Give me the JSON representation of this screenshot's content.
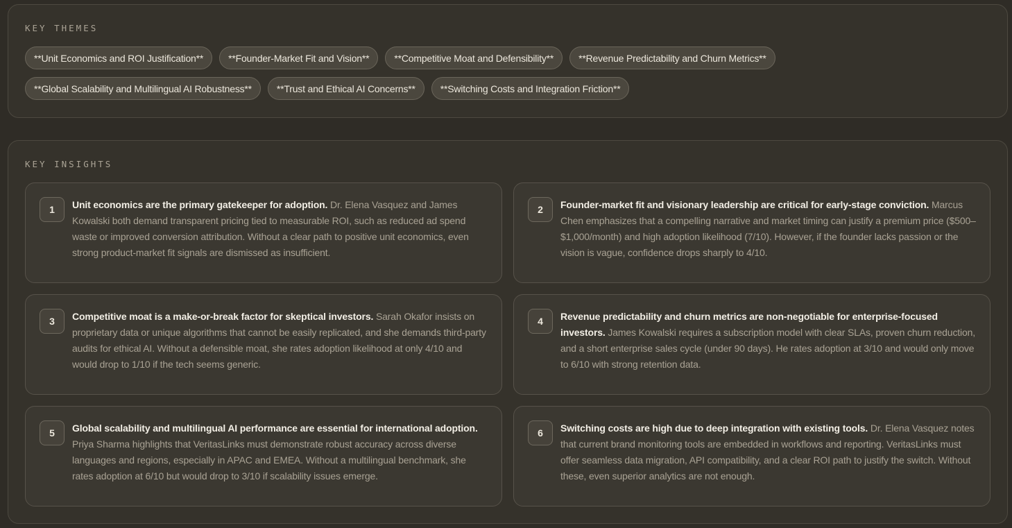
{
  "themes": {
    "label": "KEY THEMES",
    "items": [
      "**Unit Economics and ROI Justification**",
      "**Founder-Market Fit and Vision**",
      "**Competitive Moat and Defensibility**",
      "**Revenue Predictability and Churn Metrics**",
      "**Global Scalability and Multilingual AI Robustness**",
      "**Trust and Ethical AI Concerns**",
      "**Switching Costs and Integration Friction**"
    ]
  },
  "insights": {
    "label": "KEY INSIGHTS",
    "items": [
      {
        "number": "1",
        "lead": "Unit economics are the primary gatekeeper for adoption.",
        "body": "Dr. Elena Vasquez and James Kowalski both demand transparent pricing tied to measurable ROI, such as reduced ad spend waste or improved conversion attribution. Without a clear path to positive unit economics, even strong product-market fit signals are dismissed as insufficient."
      },
      {
        "number": "2",
        "lead": "Founder-market fit and visionary leadership are critical for early-stage conviction.",
        "body": "Marcus Chen emphasizes that a compelling narrative and market timing can justify a premium price ($500–$1,000/month) and high adoption likelihood (7/10). However, if the founder lacks passion or the vision is vague, confidence drops sharply to 4/10."
      },
      {
        "number": "3",
        "lead": "Competitive moat is a make-or-break factor for skeptical investors.",
        "body": "Sarah Okafor insists on proprietary data or unique algorithms that cannot be easily replicated, and she demands third-party audits for ethical AI. Without a defensible moat, she rates adoption likelihood at only 4/10 and would drop to 1/10 if the tech seems generic."
      },
      {
        "number": "4",
        "lead": "Revenue predictability and churn metrics are non-negotiable for enterprise-focused investors.",
        "body": "James Kowalski requires a subscription model with clear SLAs, proven churn reduction, and a short enterprise sales cycle (under 90 days). He rates adoption at 3/10 and would only move to 6/10 with strong retention data."
      },
      {
        "number": "5",
        "lead": "Global scalability and multilingual AI performance are essential for international adoption.",
        "body": "Priya Sharma highlights that VeritasLinks must demonstrate robust accuracy across diverse languages and regions, especially in APAC and EMEA. Without a multilingual benchmark, she rates adoption at 6/10 but would drop to 3/10 if scalability issues emerge."
      },
      {
        "number": "6",
        "lead": "Switching costs are high due to deep integration with existing tools.",
        "body": "Dr. Elena Vasquez notes that current brand monitoring tools are embedded in workflows and reporting. VeritasLinks must offer seamless data migration, API compatibility, and a clear ROI path to justify the switch. Without these, even superior analytics are not enough."
      }
    ]
  }
}
